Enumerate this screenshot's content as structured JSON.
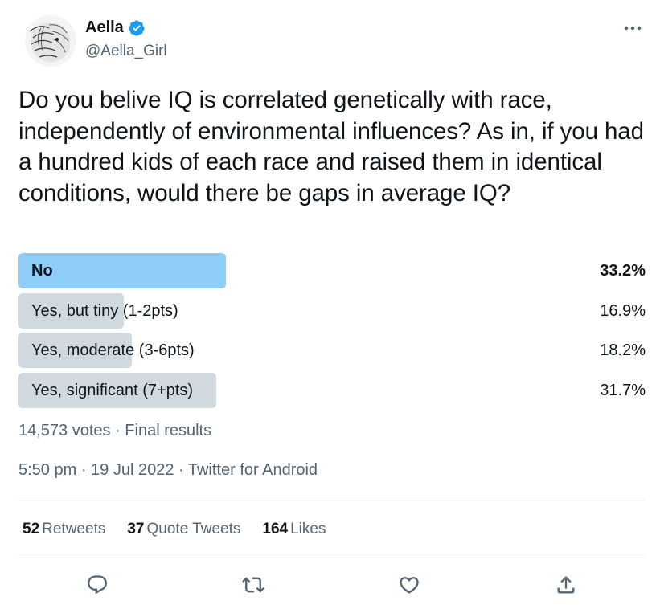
{
  "author": {
    "display_name": "Aella",
    "handle": "@Aella_Girl",
    "verified": true
  },
  "tweet": {
    "text": "Do you belive IQ is correlated genetically with race, independently of environmental influences? As in, if you had a hundred kids of each race and raised them in identical conditions, would there be gaps in average IQ?"
  },
  "poll": {
    "options": [
      {
        "label": "No",
        "percent": "33.2%",
        "fraction": 0.332,
        "winner": true
      },
      {
        "label": "Yes, but tiny (1-2pts)",
        "percent": "16.9%",
        "fraction": 0.169,
        "winner": false
      },
      {
        "label": "Yes, moderate (3-6pts)",
        "percent": "18.2%",
        "fraction": 0.182,
        "winner": false
      },
      {
        "label": "Yes, significant (7+pts)",
        "percent": "31.7%",
        "fraction": 0.317,
        "winner": false
      }
    ],
    "meta": "14,573 votes · Final results"
  },
  "timestamp": "5:50 pm · 19 Jul 2022 · Twitter for Android",
  "stats": {
    "retweets_count": "52",
    "retweets_label": "Retweets",
    "quotes_count": "37",
    "quotes_label": "Quote Tweets",
    "likes_count": "164",
    "likes_label": "Likes"
  },
  "colors": {
    "winner_bar": "#8ecdf8",
    "option_bar": "#cfd9de",
    "verified_badge": "#1d9bf0",
    "secondary_text": "#536471",
    "primary_text": "#0f1419"
  },
  "icons": {
    "more": "more-horizontal-icon",
    "reply": "reply-icon",
    "retweet": "retweet-icon",
    "like": "heart-icon",
    "share": "share-icon"
  }
}
